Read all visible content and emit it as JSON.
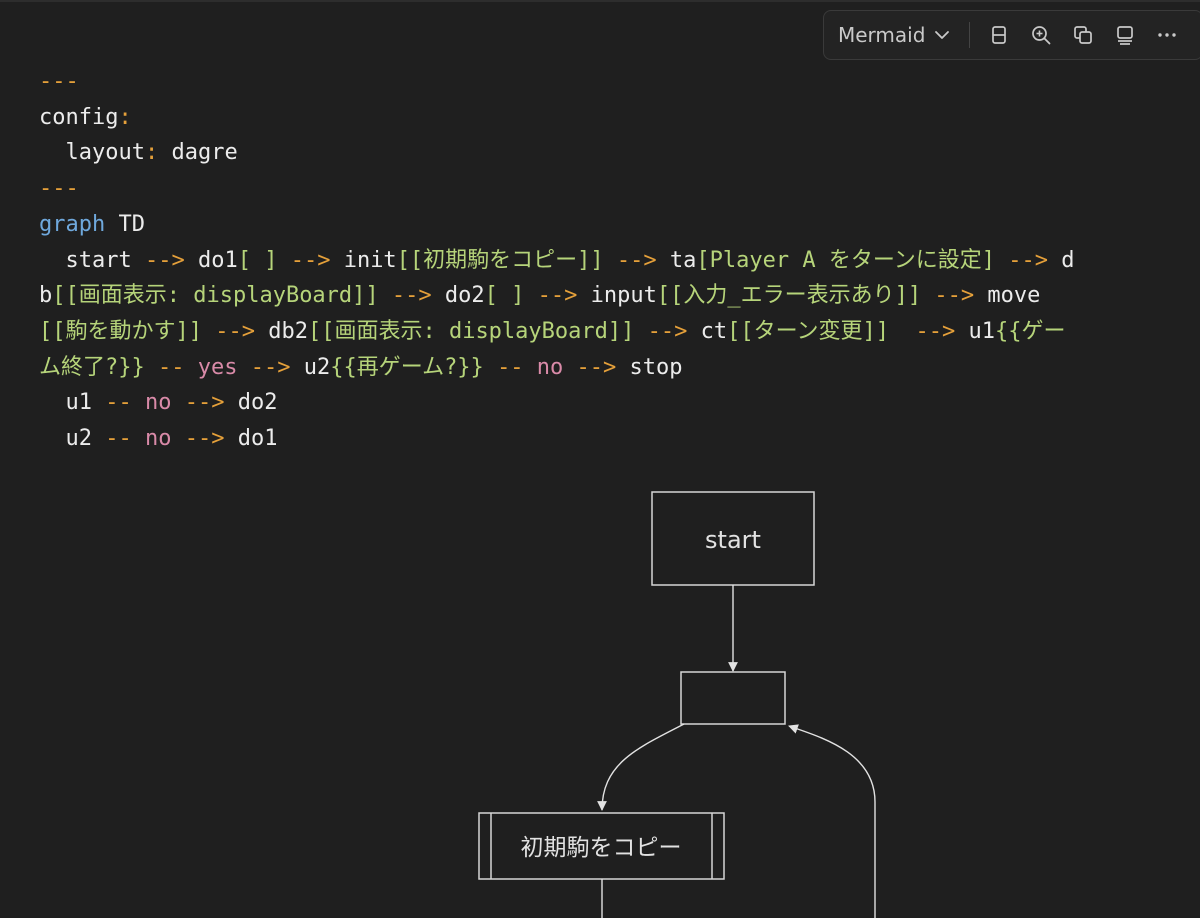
{
  "toolbar": {
    "language": "Mermaid",
    "icons": [
      "split-view-icon",
      "zoom-in-icon",
      "copy-icon",
      "preview-icon",
      "more-icon"
    ]
  },
  "code_lines": [
    [
      {
        "t": "---",
        "c": "c-sep"
      }
    ],
    [
      {
        "t": "config",
        "c": "c-id"
      },
      {
        "t": ":",
        "c": "c-colon"
      }
    ],
    [
      {
        "t": "  layout",
        "c": "c-id"
      },
      {
        "t": ":",
        "c": "c-colon"
      },
      {
        "t": " dagre",
        "c": "c-id"
      }
    ],
    [
      {
        "t": "---",
        "c": "c-sep"
      }
    ],
    [
      {
        "t": "graph",
        "c": "c-kw"
      },
      {
        "t": " TD",
        "c": "c-id"
      }
    ],
    [
      {
        "t": "  start ",
        "c": "c-id"
      },
      {
        "t": "-->",
        "c": "c-arrow"
      },
      {
        "t": " do1",
        "c": "c-id"
      },
      {
        "t": "[ ]",
        "c": "c-text"
      },
      {
        "t": " ",
        "c": "c-id"
      },
      {
        "t": "-->",
        "c": "c-arrow"
      },
      {
        "t": " init",
        "c": "c-id"
      },
      {
        "t": "[[初期駒をコピー]]",
        "c": "c-text"
      },
      {
        "t": " ",
        "c": "c-id"
      },
      {
        "t": "-->",
        "c": "c-arrow"
      },
      {
        "t": " ta",
        "c": "c-id"
      },
      {
        "t": "[Player A をターンに設定]",
        "c": "c-text"
      },
      {
        "t": " ",
        "c": "c-id"
      },
      {
        "t": "-->",
        "c": "c-arrow"
      },
      {
        "t": " d",
        "c": "c-id"
      }
    ],
    [
      {
        "t": "b",
        "c": "c-id"
      },
      {
        "t": "[[画面表示: displayBoard]]",
        "c": "c-text"
      },
      {
        "t": " ",
        "c": "c-id"
      },
      {
        "t": "-->",
        "c": "c-arrow"
      },
      {
        "t": " do2",
        "c": "c-id"
      },
      {
        "t": "[ ]",
        "c": "c-text"
      },
      {
        "t": " ",
        "c": "c-id"
      },
      {
        "t": "-->",
        "c": "c-arrow"
      },
      {
        "t": " input",
        "c": "c-id"
      },
      {
        "t": "[[入力_エラー表示あり]]",
        "c": "c-text"
      },
      {
        "t": " ",
        "c": "c-id"
      },
      {
        "t": "-->",
        "c": "c-arrow"
      },
      {
        "t": " move",
        "c": "c-id"
      }
    ],
    [
      {
        "t": "[[駒を動かす]]",
        "c": "c-text"
      },
      {
        "t": " ",
        "c": "c-id"
      },
      {
        "t": "-->",
        "c": "c-arrow"
      },
      {
        "t": " db2",
        "c": "c-id"
      },
      {
        "t": "[[画面表示: displayBoard]]",
        "c": "c-text"
      },
      {
        "t": " ",
        "c": "c-id"
      },
      {
        "t": "-->",
        "c": "c-arrow"
      },
      {
        "t": " ct",
        "c": "c-id"
      },
      {
        "t": "[[ターン変更]]",
        "c": "c-text"
      },
      {
        "t": "  ",
        "c": "c-id"
      },
      {
        "t": "-->",
        "c": "c-arrow"
      },
      {
        "t": " u1",
        "c": "c-id"
      },
      {
        "t": "{{ゲー",
        "c": "c-text"
      }
    ],
    [
      {
        "t": "ム終了?}}",
        "c": "c-text"
      },
      {
        "t": " ",
        "c": "c-id"
      },
      {
        "t": "--",
        "c": "c-arrow"
      },
      {
        "t": " yes ",
        "c": "c-label"
      },
      {
        "t": "-->",
        "c": "c-arrow"
      },
      {
        "t": " u2",
        "c": "c-id"
      },
      {
        "t": "{{再ゲーム?}}",
        "c": "c-text"
      },
      {
        "t": " ",
        "c": "c-id"
      },
      {
        "t": "--",
        "c": "c-arrow"
      },
      {
        "t": " no ",
        "c": "c-label"
      },
      {
        "t": "-->",
        "c": "c-arrow"
      },
      {
        "t": " stop",
        "c": "c-id"
      }
    ],
    [
      {
        "t": "  u1 ",
        "c": "c-id"
      },
      {
        "t": "--",
        "c": "c-arrow"
      },
      {
        "t": " no ",
        "c": "c-label"
      },
      {
        "t": "-->",
        "c": "c-arrow"
      },
      {
        "t": " do2",
        "c": "c-id"
      }
    ],
    [
      {
        "t": "  u2 ",
        "c": "c-id"
      },
      {
        "t": "--",
        "c": "c-arrow"
      },
      {
        "t": " no ",
        "c": "c-label"
      },
      {
        "t": "-->",
        "c": "c-arrow"
      },
      {
        "t": " do1",
        "c": "c-id"
      }
    ]
  ],
  "diagram": {
    "start_label": "start",
    "init_label": "初期駒をコピー"
  },
  "colors": {
    "background": "#1f1f1f",
    "keyword": "#6fa8dc",
    "arrow": "#e5a03a",
    "text": "#b6d47a",
    "edge_label": "#d98aa8"
  }
}
